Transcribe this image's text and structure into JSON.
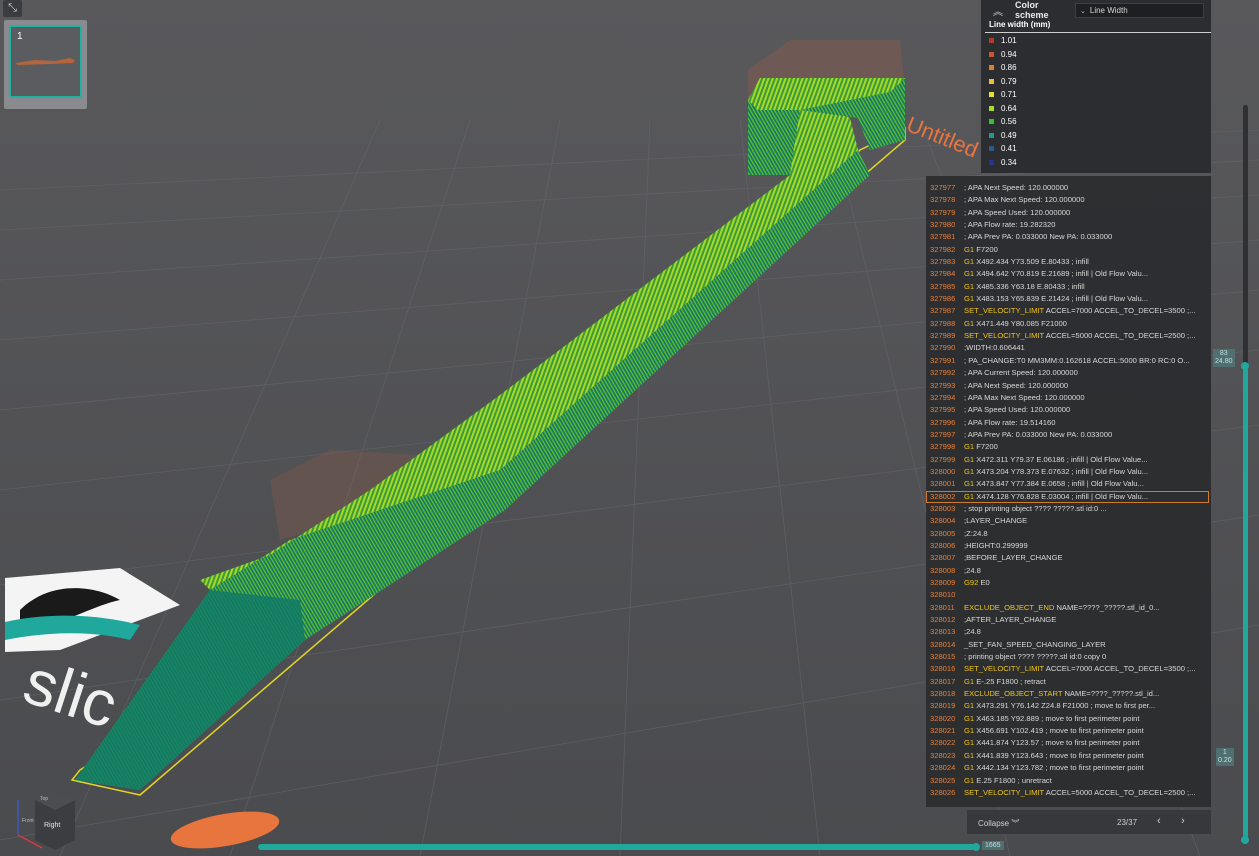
{
  "thumbnail": {
    "number": "1"
  },
  "color_scheme": {
    "title": "Color scheme",
    "selected": "Line Width",
    "legend_title": "Line width (mm)",
    "legend": [
      {
        "label": "1.01",
        "color": "#b53a26"
      },
      {
        "label": "0.94",
        "color": "#c9582c"
      },
      {
        "label": "0.86",
        "color": "#d9802e"
      },
      {
        "label": "0.79",
        "color": "#e8c22a"
      },
      {
        "label": "0.71",
        "color": "#e1e62a"
      },
      {
        "label": "0.64",
        "color": "#a6dc2a"
      },
      {
        "label": "0.56",
        "color": "#32c233"
      },
      {
        "label": "0.49",
        "color": "#1f9b8e"
      },
      {
        "label": "0.41",
        "color": "#2b5a8e"
      },
      {
        "label": "0.34",
        "color": "#24368c"
      }
    ]
  },
  "gcode": {
    "lines": [
      {
        "n": "327977",
        "cmd": "",
        "rest": "; APA Next Speed: 120.000000"
      },
      {
        "n": "327978",
        "cmd": "",
        "rest": "; APA Max Next Speed: 120.000000"
      },
      {
        "n": "327979",
        "cmd": "",
        "rest": "; APA Speed Used: 120.000000"
      },
      {
        "n": "327980",
        "cmd": "",
        "rest": "; APA Flow rate: 19.282320"
      },
      {
        "n": "327981",
        "cmd": "",
        "rest": "; APA Prev PA: 0.033000 New PA: 0.033000"
      },
      {
        "n": "327982",
        "cmd": "G1",
        "rest": "F7200"
      },
      {
        "n": "327983",
        "cmd": "G1",
        "rest": "X492.434 Y73.509 E.80433 ; infill"
      },
      {
        "n": "327984",
        "cmd": "G1",
        "rest": "X494.642 Y70.819 E.21689 ; infill | Old Flow Valu..."
      },
      {
        "n": "327985",
        "cmd": "G1",
        "rest": "X485.336 Y63.18 E.80433 ; infill"
      },
      {
        "n": "327986",
        "cmd": "G1",
        "rest": "X483.153 Y65.839 E.21424 ; infill | Old Flow Valu..."
      },
      {
        "n": "327987",
        "cmd": "SET_VELOCITY_LIMIT",
        "rest": "ACCEL=7000 ACCEL_TO_DECEL=3500 ;..."
      },
      {
        "n": "327988",
        "cmd": "G1",
        "rest": "X471.449 Y80.085 F21000"
      },
      {
        "n": "327989",
        "cmd": "SET_VELOCITY_LIMIT",
        "rest": "ACCEL=5000 ACCEL_TO_DECEL=2500 ;..."
      },
      {
        "n": "327990",
        "cmd": "",
        "rest": ";WIDTH:0.606441"
      },
      {
        "n": "327991",
        "cmd": "",
        "rest": "; PA_CHANGE:T0 MM3MM:0.162618 ACCEL:5000 BR:0 RC:0 O..."
      },
      {
        "n": "327992",
        "cmd": "",
        "rest": "; APA Current Speed: 120.000000"
      },
      {
        "n": "327993",
        "cmd": "",
        "rest": "; APA Next Speed: 120.000000"
      },
      {
        "n": "327994",
        "cmd": "",
        "rest": "; APA Max Next Speed: 120.000000"
      },
      {
        "n": "327995",
        "cmd": "",
        "rest": "; APA Speed Used: 120.000000"
      },
      {
        "n": "327996",
        "cmd": "",
        "rest": "; APA Flow rate: 19.514160"
      },
      {
        "n": "327997",
        "cmd": "",
        "rest": "; APA Prev PA: 0.033000 New PA: 0.033000"
      },
      {
        "n": "327998",
        "cmd": "G1",
        "rest": "F7200"
      },
      {
        "n": "327999",
        "cmd": "G1",
        "rest": "X472.311 Y79.37 E.06186 ; infill | Old Flow Value..."
      },
      {
        "n": "328000",
        "cmd": "G1",
        "rest": "X473.204 Y78.373 E.07632 ; infill | Old Flow Valu..."
      },
      {
        "n": "328001",
        "cmd": "G1",
        "rest": "X473.847 Y77.384 E.0658 ; infill | Old Flow Valu..."
      },
      {
        "n": "328002",
        "cmd": "G1",
        "rest": "X474.128 Y76.828 E.03004 ; infill | Old Flow Valu..."
      },
      {
        "n": "328003",
        "cmd": "",
        "rest": "; stop printing object ???? ?????.stl id:0 ..."
      },
      {
        "n": "328004",
        "cmd": "",
        "rest": ";LAYER_CHANGE"
      },
      {
        "n": "328005",
        "cmd": "",
        "rest": ";Z:24.8"
      },
      {
        "n": "328006",
        "cmd": "",
        "rest": ";HEIGHT:0.299999"
      },
      {
        "n": "328007",
        "cmd": "",
        "rest": ";BEFORE_LAYER_CHANGE"
      },
      {
        "n": "328008",
        "cmd": "",
        "rest": ";24.8"
      },
      {
        "n": "328009",
        "cmd": "G92",
        "rest": "E0"
      },
      {
        "n": "328010",
        "cmd": "",
        "rest": ""
      },
      {
        "n": "328011",
        "cmd": "EXCLUDE_OBJECT_END",
        "rest": "NAME=????_?????.stl_id_0..."
      },
      {
        "n": "328012",
        "cmd": "",
        "rest": ";AFTER_LAYER_CHANGE"
      },
      {
        "n": "328013",
        "cmd": "",
        "rest": ";24.8"
      },
      {
        "n": "328014",
        "cmd": "",
        "rest": "_SET_FAN_SPEED_CHANGING_LAYER"
      },
      {
        "n": "328015",
        "cmd": "",
        "rest": "; printing object ???? ?????.stl id:0 copy 0"
      },
      {
        "n": "328016",
        "cmd": "SET_VELOCITY_LIMIT",
        "rest": "ACCEL=7000 ACCEL_TO_DECEL=3500 ;..."
      },
      {
        "n": "328017",
        "cmd": "G1",
        "rest": "E-.25 F1800 ; retract"
      },
      {
        "n": "328018",
        "cmd": "EXCLUDE_OBJECT_START",
        "rest": "NAME=????_?????.stl_id..."
      },
      {
        "n": "328019",
        "cmd": "G1",
        "rest": "X473.291 Y76.142 Z24.8 F21000 ; move to first per..."
      },
      {
        "n": "328020",
        "cmd": "G1",
        "rest": "X463.185 Y92.889 ; move to first perimeter point"
      },
      {
        "n": "328021",
        "cmd": "G1",
        "rest": "X456.691 Y102.419 ; move to first perimeter point"
      },
      {
        "n": "328022",
        "cmd": "G1",
        "rest": "X441.874 Y123.57 ; move to first perimeter point"
      },
      {
        "n": "328023",
        "cmd": "G1",
        "rest": "X441.839 Y123.643 ; move to first perimeter point"
      },
      {
        "n": "328024",
        "cmd": "G1",
        "rest": "X442.134 Y123.782 ; move to first perimeter point"
      },
      {
        "n": "328025",
        "cmd": "G1",
        "rest": "E.25 F1800 ; unretract"
      },
      {
        "n": "328026",
        "cmd": "SET_VELOCITY_LIMIT",
        "rest": "ACCEL=5000 ACCEL_TO_DECEL=2500 ;..."
      }
    ],
    "selected_line": "328002",
    "collapse_label": "Collapse",
    "page": "23/37"
  },
  "layer_slider": {
    "top_label_1": "83",
    "top_label_2": "24.80",
    "bottom_label_1": "1",
    "bottom_label_2": "0.20"
  },
  "move_slider": {
    "value": "1665"
  },
  "view_cube": {
    "face": "Right",
    "top": "Top",
    "front": "Front"
  },
  "watermark": {
    "text": "Untitled"
  }
}
